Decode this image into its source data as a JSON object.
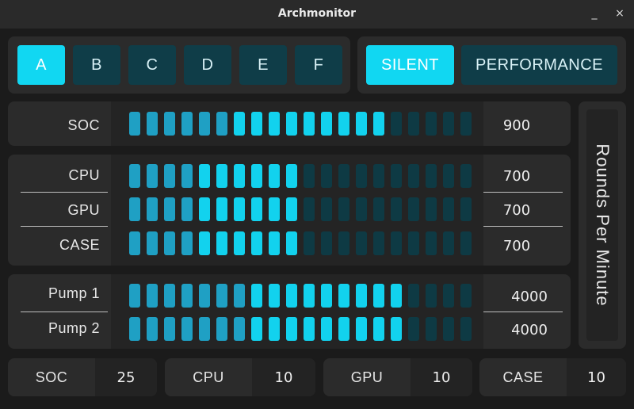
{
  "window": {
    "title": "Archmonitor",
    "minimize": "_",
    "close": "×"
  },
  "profiles": [
    {
      "label": "A",
      "active": true
    },
    {
      "label": "B",
      "active": false
    },
    {
      "label": "C",
      "active": false
    },
    {
      "label": "D",
      "active": false
    },
    {
      "label": "E",
      "active": false
    },
    {
      "label": "F",
      "active": false
    }
  ],
  "modes": [
    {
      "label": "SILENT",
      "active": true
    },
    {
      "label": "PERFORMANCE",
      "active": false
    }
  ],
  "fans": {
    "soc": {
      "label": "SOC",
      "value": "900",
      "level": 15,
      "total": 20
    },
    "cpu": {
      "label": "CPU",
      "value": "700",
      "level": 10,
      "total": 20
    },
    "gpu": {
      "label": "GPU",
      "value": "700",
      "level": 10,
      "total": 20
    },
    "case": {
      "label": "CASE",
      "value": "700",
      "level": 10,
      "total": 20
    }
  },
  "pumps": {
    "pump1": {
      "label": "Pump 1",
      "value": "4000",
      "level": 16,
      "total": 20
    },
    "pump2": {
      "label": "Pump 2",
      "value": "4000",
      "level": 16,
      "total": 20
    }
  },
  "unit_label": "Rounds Per Minute",
  "temps": [
    {
      "label": "SOC",
      "value": "25"
    },
    {
      "label": "CPU",
      "value": "10"
    },
    {
      "label": "GPU",
      "value": "10"
    },
    {
      "label": "CASE",
      "value": "10"
    }
  ],
  "colors": {
    "accent": "#11d7f2",
    "bar_on": "#1fa0c4",
    "bar_off": "#0e3a44",
    "button_inactive": "#0f3d48"
  }
}
